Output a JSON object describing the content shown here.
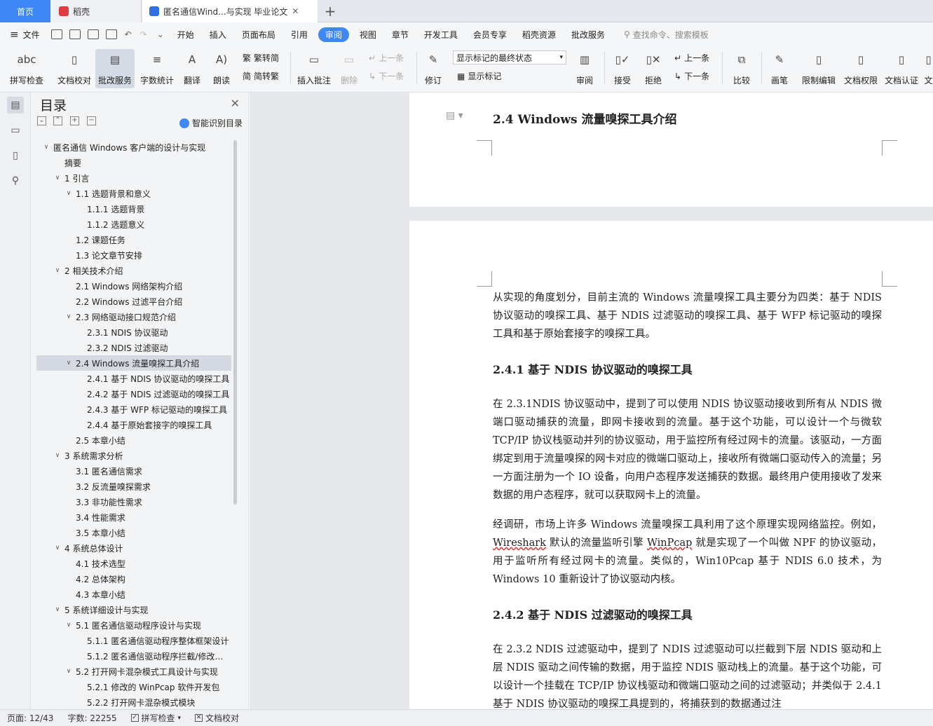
{
  "tabs": {
    "home": "首页",
    "daoke": "稻壳",
    "doc": "匿名通信Wind...与实现 毕业论文",
    "add": "+"
  },
  "menu": {
    "file": "文件",
    "items": [
      "开始",
      "插入",
      "页面布局",
      "引用",
      "审阅",
      "视图",
      "章节",
      "开发工具",
      "会员专享",
      "稻壳资源",
      "批改服务"
    ],
    "active": "审阅",
    "search": "查找命令、搜索模板"
  },
  "ribbon": {
    "spell": "拼写检查",
    "proof": "文档校对",
    "correct": "批改服务",
    "wordcount": "字数统计",
    "translate": "翻译",
    "read": "朗读",
    "trad": "繁转简",
    "simp": "简转繁",
    "insert_comment": "插入批注",
    "delete": "删除",
    "prev": "上一条",
    "next": "下一条",
    "revise": "修订",
    "display_state": "显示标记的最终状态",
    "show_marks": "显示标记",
    "review": "审阅",
    "accept": "接受",
    "reject": "拒绝",
    "prev2": "上一条",
    "next2": "下一条",
    "compare": "比较",
    "pen": "画笔",
    "restrict": "限制编辑",
    "perm": "文档权限",
    "cert": "文档认证",
    "more": "文"
  },
  "toc": {
    "title": "目录",
    "smart": "智能识别目录",
    "items": [
      {
        "level": 0,
        "text": "匿名通信 Windows 客户端的设计与实现",
        "caret": "v"
      },
      {
        "level": 1,
        "text": "摘要",
        "caret": ""
      },
      {
        "level": 1,
        "text": "1 引言",
        "caret": "v"
      },
      {
        "level": 2,
        "text": "1.1 选题背景和意义",
        "caret": "v"
      },
      {
        "level": 3,
        "text": "1.1.1 选题背景",
        "caret": ""
      },
      {
        "level": 3,
        "text": "1.1.2 选题意义",
        "caret": ""
      },
      {
        "level": 2,
        "text": "1.2 课题任务",
        "caret": ""
      },
      {
        "level": 2,
        "text": "1.3 论文章节安排",
        "caret": ""
      },
      {
        "level": 1,
        "text": "2 相关技术介绍",
        "caret": "v"
      },
      {
        "level": 2,
        "text": "2.1 Windows 网络架构介绍",
        "caret": ""
      },
      {
        "level": 2,
        "text": "2.2 Windows 过滤平台介绍",
        "caret": ""
      },
      {
        "level": 2,
        "text": "2.3 网络驱动接口规范介绍",
        "caret": "v"
      },
      {
        "level": 3,
        "text": "2.3.1 NDIS 协议驱动",
        "caret": ""
      },
      {
        "level": 3,
        "text": "2.3.2 NDIS 过滤驱动",
        "caret": ""
      },
      {
        "level": 2,
        "text": "2.4 Windows 流量嗅探工具介绍",
        "caret": "v",
        "selected": true
      },
      {
        "level": 3,
        "text": "2.4.1 基于 NDIS 协议驱动的嗅探工具",
        "caret": ""
      },
      {
        "level": 3,
        "text": "2.4.2 基于 NDIS 过滤驱动的嗅探工具",
        "caret": ""
      },
      {
        "level": 3,
        "text": "2.4.3 基于 WFP 标记驱动的嗅探工具",
        "caret": ""
      },
      {
        "level": 3,
        "text": "2.4.4 基于原始套接字的嗅探工具",
        "caret": ""
      },
      {
        "level": 2,
        "text": "2.5 本章小结",
        "caret": ""
      },
      {
        "level": 1,
        "text": "3 系统需求分析",
        "caret": "v"
      },
      {
        "level": 2,
        "text": "3.1 匿名通信需求",
        "caret": ""
      },
      {
        "level": 2,
        "text": "3.2 反流量嗅探需求",
        "caret": ""
      },
      {
        "level": 2,
        "text": "3.3 非功能性需求",
        "caret": ""
      },
      {
        "level": 2,
        "text": "3.4 性能需求",
        "caret": ""
      },
      {
        "level": 2,
        "text": "3.5 本章小结",
        "caret": ""
      },
      {
        "level": 1,
        "text": "4 系统总体设计",
        "caret": "v"
      },
      {
        "level": 2,
        "text": "4.1 技术选型",
        "caret": ""
      },
      {
        "level": 2,
        "text": "4.2 总体架构",
        "caret": ""
      },
      {
        "level": 2,
        "text": "4.3 本章小结",
        "caret": ""
      },
      {
        "level": 1,
        "text": "5 系统详细设计与实现",
        "caret": "v"
      },
      {
        "level": 2,
        "text": "5.1 匿名通信驱动程序设计与实现",
        "caret": "v"
      },
      {
        "level": 3,
        "text": "5.1.1 匿名通信驱动程序整体框架设计",
        "caret": ""
      },
      {
        "level": 3,
        "text": "5.1.2 匿名通信驱动程序拦截/修改数据包",
        "caret": ""
      },
      {
        "level": 2,
        "text": "5.2 打开网卡混杂模式工具设计与实现",
        "caret": "v"
      },
      {
        "level": 3,
        "text": "5.2.1 修改的 WinPcap 软件开发包",
        "caret": ""
      },
      {
        "level": 3,
        "text": "5.2.2 打开网卡混杂模式模块",
        "caret": ""
      }
    ]
  },
  "doc": {
    "h_24": "2.4 Windows 流量嗅探工具介绍",
    "p1": "从实现的角度划分，目前主流的 Windows 流量嗅探工具主要分为四类：基于 NDIS 协议驱动的嗅探工具、基于 NDIS 过滤驱动的嗅探工具、基于 WFP 标记驱动的嗅探工具和基于原始套接字的嗅探工具。",
    "h_241": "2.4.1 基于 NDIS 协议驱动的嗅探工具",
    "p2": "在 2.3.1NDIS 协议驱动中，提到了可以使用 NDIS 协议驱动接收到所有从 NDIS 微端口驱动捕获的流量，即网卡接收到的流量。基于这个功能，可以设计一个与微软 TCP/IP 协议栈驱动并列的协议驱动，用于监控所有经过网卡的流量。该驱动，一方面绑定到用于流量嗅探的网卡对应的微端口驱动上，接收所有微端口驱动传入的流量；另一方面注册为一个 IO 设备，向用户态程序发送捕获的数据。最终用户使用接收了发来数据的用户态程序，就可以获取网卡上的流量。",
    "p3a": "经调研，市场上许多 Windows 流量嗅探工具利用了这个原理实现网络监控。例如，",
    "p3b": "Wireshark",
    "p3c": " 默认的流量监听引擎 ",
    "p3d": "WinPcap",
    "p3e": " 就是实现了一个叫做 NPF 的协议驱动，用于监听所有经过网卡的流量。类似的，Win10Pcap 基于 NDIS 6.0 技术，为 Windows 10 重新设计了协议驱动内核。",
    "h_242": "2.4.2 基于 NDIS 过滤驱动的嗅探工具",
    "p4": "在 2.3.2 NDIS 过滤驱动中，提到了 NDIS 过滤驱动可以拦截到下层 NDIS 驱动和上层 NDIS 驱动之间传输的数据，用于监控 NDIS 驱动栈上的流量。基于这个功能，可以设计一个挂载在 TCP/IP 协议栈驱动和微端口驱动之间的过滤驱动；并类似于 2.4.1 基于 NDIS 协议驱动的嗅探工具提到的，将捕获到的数据通过注"
  },
  "status": {
    "page": "页面: 12/43",
    "words": "字数: 22255",
    "spell": "拼写检查",
    "proof": "文档校对"
  },
  "colors": {
    "accent": "#3e87f5",
    "selected": "#d5dae2"
  }
}
